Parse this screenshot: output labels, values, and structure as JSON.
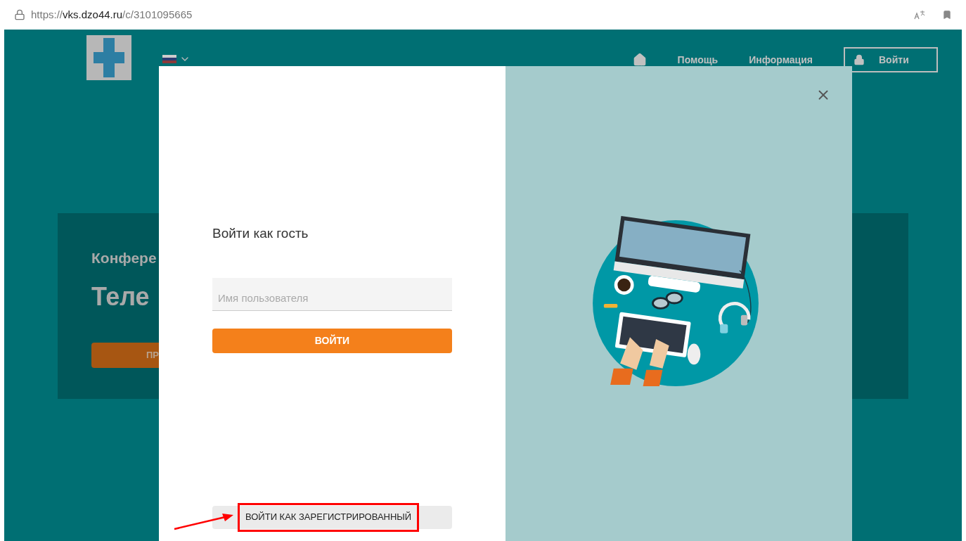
{
  "browser": {
    "url_scheme": "https://",
    "url_host": "vks.dzo44.ru",
    "url_path": "/c/3101095665"
  },
  "nav": {
    "links": [
      "Помощь",
      "Информация"
    ],
    "login": "Войти"
  },
  "hero": {
    "subtitle": "Конфере",
    "title": "Теле",
    "button": "ПР"
  },
  "modal": {
    "title": "Войти как гость",
    "username": {
      "placeholder": "Имя пользователя"
    },
    "submit": "ВОЙТИ",
    "registered": "ВОЙТИ КАК ЗАРЕГИСТРИРОВАННЫЙ"
  }
}
